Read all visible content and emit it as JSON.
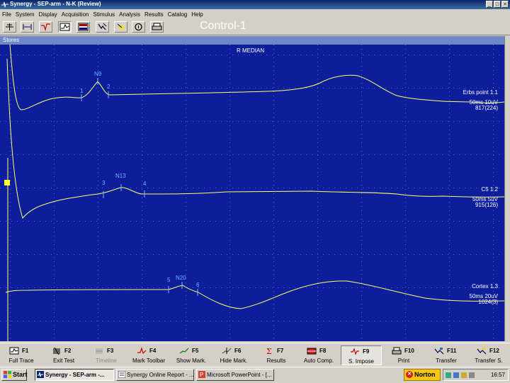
{
  "window": {
    "title": "Synergy - SEP-arm - N-K (Review)",
    "buttons": [
      "_",
      "□",
      "×"
    ]
  },
  "menu": [
    "File",
    "System",
    "Display",
    "Acquisition",
    "Stimulus",
    "Analysis",
    "Results",
    "Catalog",
    "Help"
  ],
  "toolbar": {
    "caption": "Control-1",
    "icons": [
      "markers-icon",
      "expand-icon",
      "cursor-icon",
      "trace-display-icon",
      "layout-icon",
      "pointer-icon",
      "flag-icon",
      "help-icon",
      "print-icon"
    ]
  },
  "pane": {
    "header": "Stores",
    "plot_title": "R MEDIAN"
  },
  "traces": [
    {
      "label": "Erbs point 1.1",
      "scale": "50ms 10uV",
      "sub": "817(224)",
      "markers": [
        {
          "id": "1",
          "t": "1"
        },
        {
          "id": "N9",
          "t": "N9"
        },
        {
          "id": "2",
          "t": "2"
        }
      ]
    },
    {
      "label": "C5 1.2",
      "scale": "50ms 5uV",
      "sub": "915(126)",
      "markers": [
        {
          "id": "3",
          "t": "3"
        },
        {
          "id": "N13",
          "t": "N13"
        },
        {
          "id": "4",
          "t": "4"
        }
      ]
    },
    {
      "label": "Cortex 1.3",
      "scale": "50ms 20uV",
      "sub": "1024(3)",
      "markers": [
        {
          "id": "5",
          "t": "5"
        },
        {
          "id": "N20",
          "t": "N20"
        },
        {
          "id": "6",
          "t": "6"
        }
      ]
    }
  ],
  "fkeys": [
    {
      "key": "F1",
      "label": "Full Trace",
      "icon": "full-trace-icon"
    },
    {
      "key": "F2",
      "label": "Exit Test",
      "icon": "exit-test-icon"
    },
    {
      "key": "F3",
      "label": "Timeline",
      "icon": "timeline-icon",
      "disabled": true
    },
    {
      "key": "F4",
      "label": "Mark Toolbar",
      "icon": "mark-toolbar-icon"
    },
    {
      "key": "F5",
      "label": "Show Mark.",
      "icon": "show-mark-icon"
    },
    {
      "key": "F6",
      "label": "Hide Mark.",
      "icon": "hide-mark-icon"
    },
    {
      "key": "F7",
      "label": "Results",
      "icon": "results-icon"
    },
    {
      "key": "F8",
      "label": "Auto Comp.",
      "icon": "auto-comp-icon"
    },
    {
      "key": "F9",
      "label": "S. Impose",
      "icon": "superimpose-icon",
      "pressed": true
    },
    {
      "key": "F10",
      "label": "Print",
      "icon": "print-icon"
    },
    {
      "key": "F11",
      "label": "Transfer",
      "icon": "transfer-icon"
    },
    {
      "key": "F12",
      "label": "Transfer S.",
      "icon": "transfer-s-icon"
    }
  ],
  "taskbar": {
    "start": "Start",
    "tasks": [
      {
        "label": "Synergy - SEP-arm -...",
        "active": true
      },
      {
        "label": "Synergy Online Report - ..."
      },
      {
        "label": "Microsoft PowerPoint - [..."
      }
    ],
    "norton": "Norton",
    "clock": "16:57"
  },
  "colors": {
    "plot_bg": "#0e1e9a",
    "trace": "#ffff66",
    "marker_label": "#6fb8ff",
    "title_bar": "#0a246a"
  }
}
